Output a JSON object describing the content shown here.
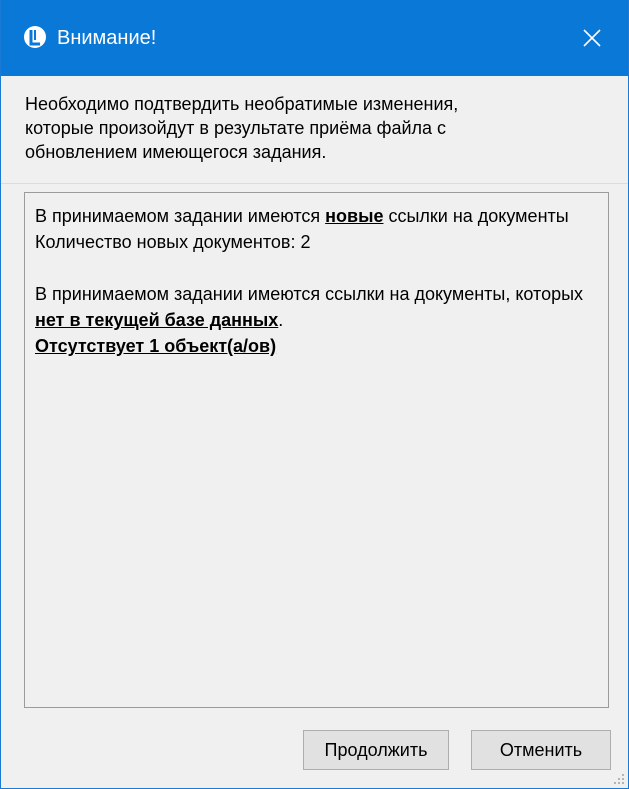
{
  "window": {
    "title": "Внимание!",
    "titlebar_color": "#0a78d7",
    "icon": "app-logo-icon",
    "close_icon": "close-icon"
  },
  "intro": {
    "lines": [
      "Необходимо подтвердить необратимые изменения,",
      "которые произойдут в результате приёма файла с",
      "обновлением имеющегося задания."
    ]
  },
  "details": {
    "p1_before": "В принимаемом задании имеются ",
    "p1_bold": "новые",
    "p1_after": " ссылки на документы",
    "p1_count": "Количество новых документов: 2",
    "p2_before": "В принимаемом задании имеются ссылки на документы, которых ",
    "p2_bold": "нет в текущей базе данных",
    "p2_after": ".",
    "p2_missing": "Отсутствует 1 объект(а/ов)"
  },
  "buttons": {
    "continue_label": "Продолжить",
    "cancel_label": "Отменить"
  }
}
